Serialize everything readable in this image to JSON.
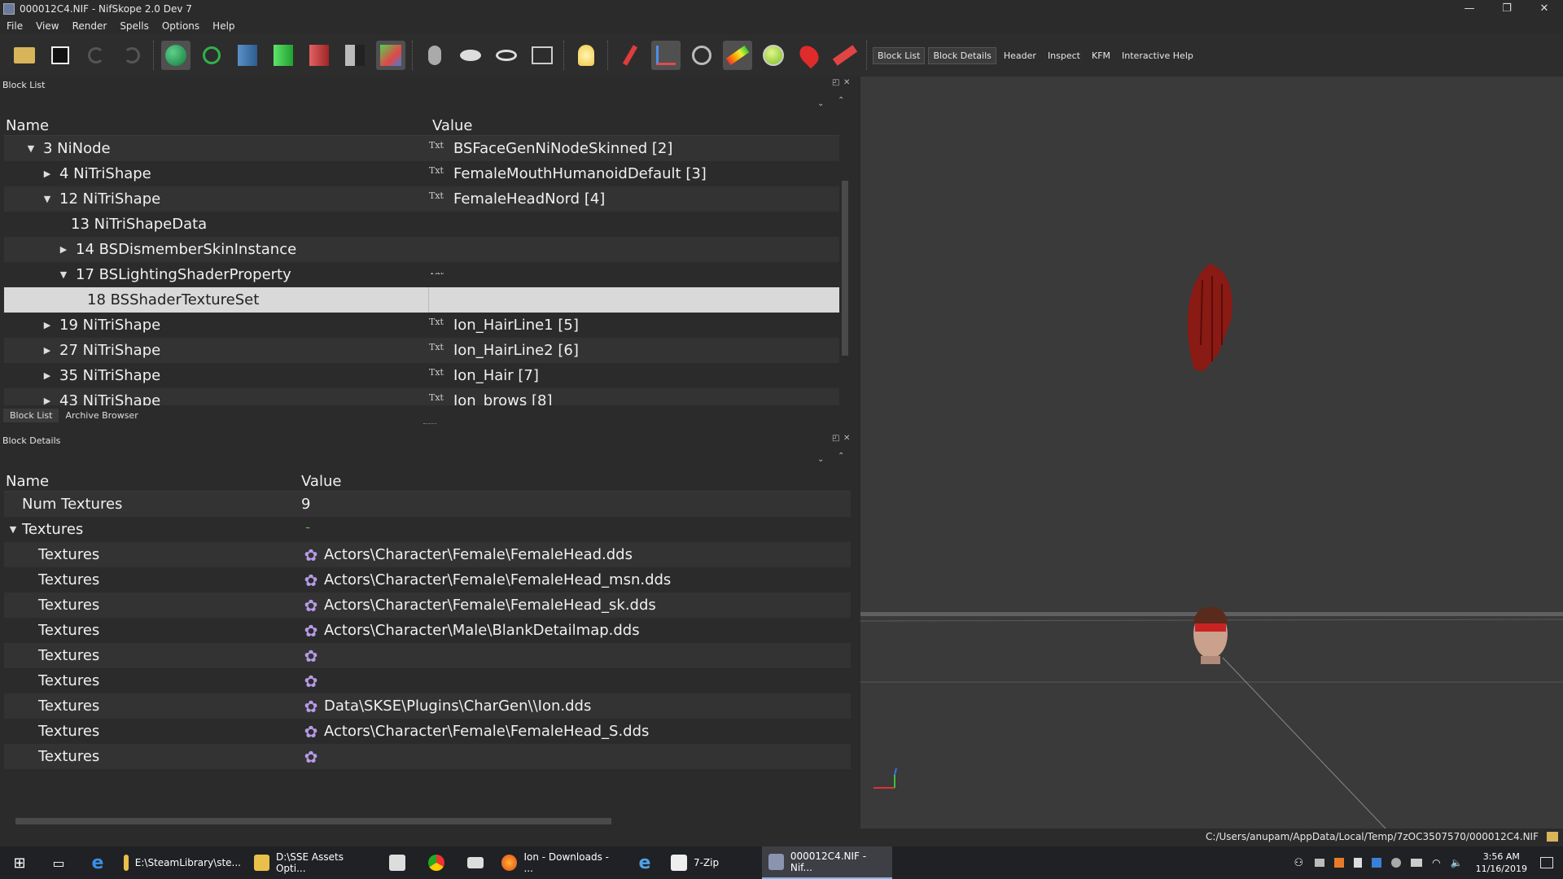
{
  "window": {
    "title": "000012C4.NIF - NifSkope 2.0 Dev 7",
    "controls": [
      "—",
      "❐",
      "✕"
    ]
  },
  "menu": [
    "File",
    "View",
    "Render",
    "Spells",
    "Options",
    "Help"
  ],
  "toolbar": {
    "text_buttons": [
      "Block List",
      "Block Details",
      "Header",
      "Inspect",
      "KFM",
      "Interactive Help"
    ]
  },
  "block_list": {
    "title": "Block List",
    "headers": {
      "name": "Name",
      "value": "Value"
    },
    "rows": [
      {
        "name": "3 NiNode",
        "value": "BSFaceGenNiNodeSkinned [2]",
        "txt": true
      },
      {
        "name": "4 NiTriShape",
        "value": "FemaleMouthHumanoidDefault [3]",
        "txt": true
      },
      {
        "name": "12 NiTriShape",
        "value": "FemaleHeadNord [4]",
        "txt": true
      },
      {
        "name": "13 NiTriShapeData",
        "value": "",
        "txt": false
      },
      {
        "name": "14 BSDismemberSkinInstance",
        "value": "",
        "txt": false
      },
      {
        "name": "17 BSLightingShaderProperty",
        "value": "",
        "txt": true
      },
      {
        "name": "18 BSShaderTextureSet",
        "value": "",
        "txt": false
      },
      {
        "name": "19 NiTriShape",
        "value": "Ion_HairLine1 [5]",
        "txt": true
      },
      {
        "name": "27 NiTriShape",
        "value": "Ion_HairLine2 [6]",
        "txt": true
      },
      {
        "name": "35 NiTriShape",
        "value": "Ion_Hair [7]",
        "txt": true
      },
      {
        "name": "43 NiTriShape",
        "value": "Ion_brows [8]",
        "txt": true
      }
    ],
    "tabs": [
      "Block List",
      "Archive Browser"
    ]
  },
  "block_details": {
    "title": "Block Details",
    "headers": {
      "name": "Name",
      "value": "Value"
    },
    "rows": [
      {
        "name": "Num Textures",
        "value": "9"
      },
      {
        "name": "Textures",
        "value": ""
      },
      {
        "name": "Textures",
        "value": "Actors\\Character\\Female\\FemaleHead.dds"
      },
      {
        "name": "Textures",
        "value": "Actors\\Character\\Female\\FemaleHead_msn.dds"
      },
      {
        "name": "Textures",
        "value": "Actors\\Character\\Female\\FemaleHead_sk.dds"
      },
      {
        "name": "Textures",
        "value": "Actors\\Character\\Male\\BlankDetailmap.dds"
      },
      {
        "name": "Textures",
        "value": ""
      },
      {
        "name": "Textures",
        "value": ""
      },
      {
        "name": "Textures",
        "value": "Data\\SKSE\\Plugins\\CharGen\\\\Ion.dds"
      },
      {
        "name": "Textures",
        "value": "Actors\\Character\\Female\\FemaleHead_S.dds"
      },
      {
        "name": "Textures",
        "value": ""
      }
    ]
  },
  "status": {
    "path": "C:/Users/anupam/AppData/Local/Temp/7zOC3507570/000012C4.NIF"
  },
  "taskbar": {
    "items": [
      {
        "label": "E:\\SteamLibrary\\ste..."
      },
      {
        "label": "D:\\SSE Assets Opti..."
      },
      {
        "label": "Ion - Downloads - ..."
      },
      {
        "label": "7-Zip"
      },
      {
        "label": "000012C4.NIF - Nif..."
      }
    ],
    "time": "3:56 AM",
    "date": "11/16/2019"
  }
}
